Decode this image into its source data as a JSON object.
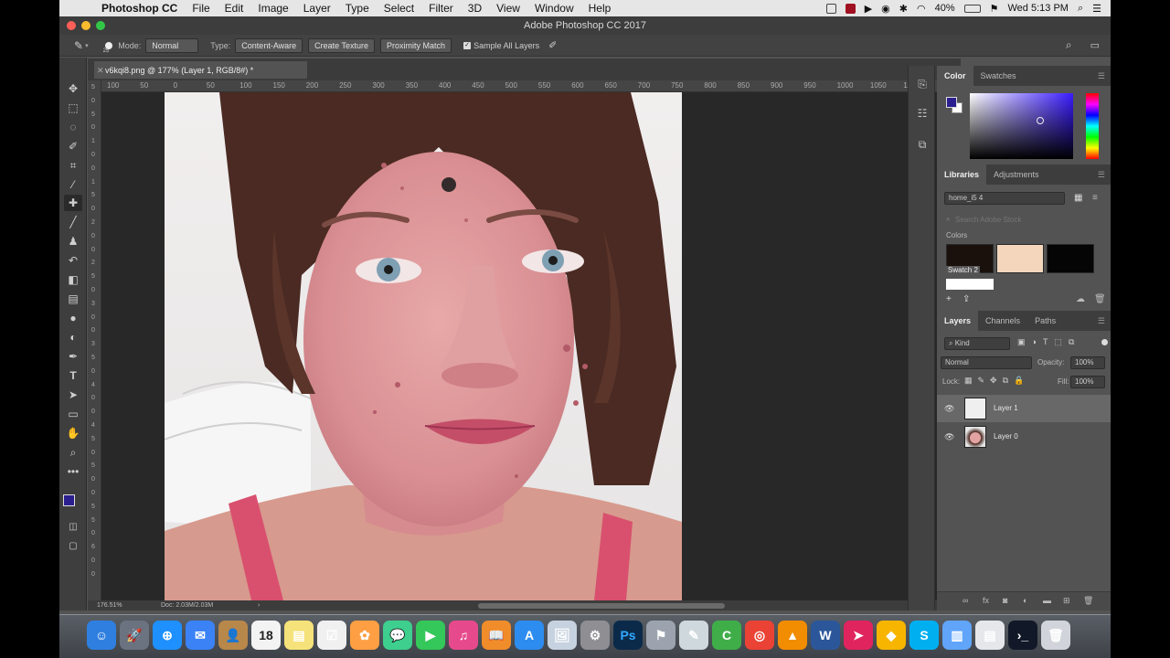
{
  "menubar": {
    "app_name": "Photoshop CC",
    "items": [
      "File",
      "Edit",
      "Image",
      "Layer",
      "Type",
      "Select",
      "Filter",
      "3D",
      "View",
      "Window",
      "Help"
    ],
    "battery": "40%",
    "clock": "Wed 5:13 PM"
  },
  "window": {
    "title": "Adobe Photoshop CC 2017"
  },
  "options": {
    "brush_size": "25",
    "mode_label": "Mode:",
    "mode_value": "Normal",
    "type_label": "Type:",
    "type_options": [
      "Content-Aware",
      "Create Texture",
      "Proximity Match"
    ],
    "sample_all_layers": "Sample All Layers"
  },
  "document": {
    "tab_title": "v6kqi8.png @ 177% (Layer 1, RGB/8#) *",
    "zoom": "176.51%",
    "doc_info": "Doc: 2.03M/2.03M"
  },
  "rulers": {
    "top": [
      "100",
      "50",
      "0",
      "50",
      "100",
      "150",
      "200",
      "250",
      "300",
      "350",
      "400",
      "450",
      "500",
      "550",
      "600",
      "650",
      "700",
      "750",
      "800",
      "850",
      "900",
      "950",
      "1000",
      "1050",
      "1100"
    ],
    "left": [
      "5",
      "0",
      "5",
      "0",
      "1",
      "0",
      "0",
      "1",
      "5",
      "0",
      "2",
      "0",
      "0",
      "2",
      "5",
      "0",
      "3",
      "0",
      "0",
      "3",
      "5",
      "0",
      "4",
      "0",
      "0",
      "4",
      "5",
      "0",
      "5",
      "0",
      "0",
      "5",
      "5",
      "0",
      "6",
      "0",
      "0"
    ]
  },
  "panels": {
    "color_tabs": [
      "Color",
      "Swatches"
    ],
    "library_tabs": [
      "Libraries",
      "Adjustments"
    ],
    "library_name": "home_i5 4",
    "search_placeholder": "Search Adobe Stock",
    "colors_heading": "Colors",
    "swatch_label": "Swatch 2",
    "layers_tabs": [
      "Layers",
      "Channels",
      "Paths"
    ],
    "kind_filter": "Kind",
    "blend_mode": "Normal",
    "opacity_label": "Opacity:",
    "opacity_value": "100%",
    "lock_label": "Lock:",
    "fill_label": "Fill:",
    "fill_value": "100%",
    "layers": [
      {
        "name": "Layer 1",
        "selected": true
      },
      {
        "name": "Layer 0",
        "selected": false
      }
    ]
  },
  "colors": {
    "foreground": "#2b1f8f",
    "swatch_dark": "#1a100c",
    "swatch_skin": "#f3d6bc",
    "swatch_black": "#050505",
    "swatch_white": "#ffffff"
  },
  "dock": {
    "apps": [
      "Finder",
      "Launchpad",
      "Safari",
      "Mail",
      "Contacts",
      "Calendar",
      "Notes",
      "Reminders",
      "Photos",
      "Messages",
      "FaceTime",
      "iTunes",
      "iBooks",
      "App Store",
      "Preview",
      "System Preferences",
      "Photoshop",
      "Boot Camp",
      "Script Editor",
      "Camtasia",
      "Chrome",
      "VLC",
      "Word",
      "App",
      "Sketch",
      "Skype",
      "Folder",
      "File",
      "Terminal",
      "Trash"
    ],
    "calendar_day": "18",
    "photoshop_label": "Ps"
  }
}
